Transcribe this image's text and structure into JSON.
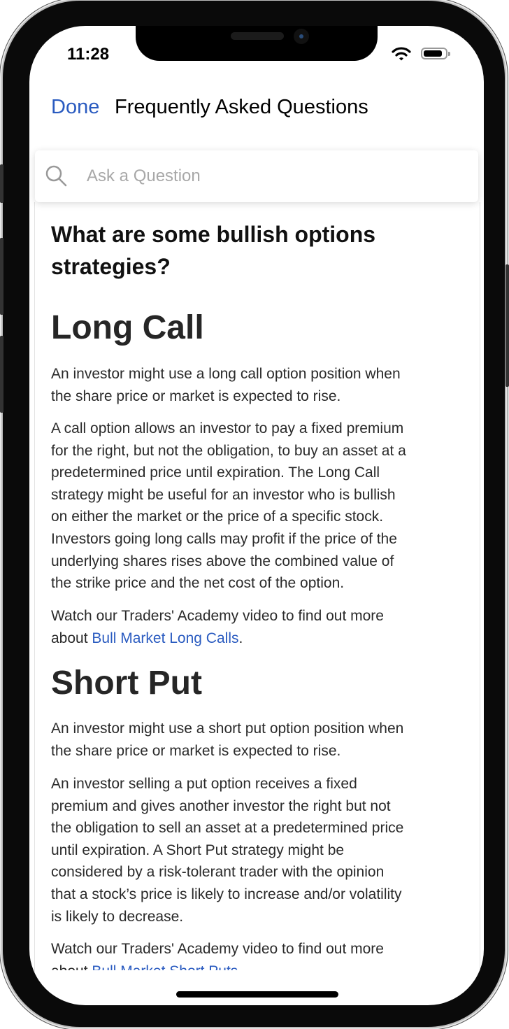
{
  "status_bar": {
    "time": "11:28"
  },
  "nav": {
    "done_label": "Done",
    "title": "Frequently Asked Questions"
  },
  "search": {
    "placeholder": "Ask a Question",
    "value": ""
  },
  "article": {
    "question": [
      "What are some bullish options",
      "strategies?"
    ],
    "sections": [
      {
        "heading": "Long Call",
        "p1": [
          "An investor might use a long call option position when",
          "the share price or market is expected to rise."
        ],
        "p2": [
          "A call option allows an investor to pay a fixed premium",
          "for the right, but not the obligation, to buy an asset at a",
          "predetermined price until expiration.  The Long Call",
          "strategy might be useful for an investor who is bullish",
          "on either the market or the price of a specific stock.",
          "Investors going long calls may profit if the price of the",
          "underlying shares rises above the combined value of",
          "the strike price and the net cost of the option."
        ],
        "watch_line1": "Watch our Traders' Academy video to find out more",
        "watch_prefix": "about ",
        "link": "Bull Market Long Calls",
        "watch_suffix": "."
      },
      {
        "heading": "Short Put",
        "p1": [
          "An investor might use a short put option position when",
          "the share price or market is expected to rise."
        ],
        "p2": [
          "An investor selling a put option receives a fixed",
          "premium and gives another investor the right but not",
          "the obligation to sell an asset at a predetermined price",
          "until expiration.  A Short Put strategy might be",
          "considered by a risk-tolerant trader with the opinion",
          "that a stock’s price is likely to increase and/or volatility",
          "is likely to decrease."
        ],
        "watch_line1": "Watch our Traders' Academy video to find out more",
        "watch_prefix": "about ",
        "link": "Bull Market Short Puts",
        "watch_suffix": "."
      }
    ]
  },
  "colors": {
    "accent": "#2a5bc0",
    "text": "#2a2a2a"
  }
}
